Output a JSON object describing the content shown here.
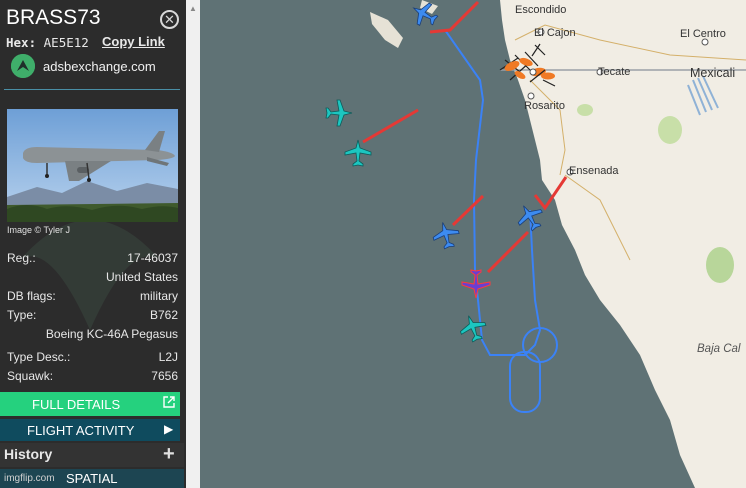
{
  "aircraft": {
    "callsign": "BRASS73",
    "hex_label": "Hex:",
    "hex_value": "AE5E12",
    "copy_link": "Copy Link",
    "source_site": "adsbexchange.com",
    "photo_credit": "Image © Tyler J",
    "details": [
      {
        "label": "Reg.:",
        "value": "17-46037"
      },
      {
        "label": "",
        "value": "United States"
      },
      {
        "label": "DB flags:",
        "value": "military"
      },
      {
        "label": "Type:",
        "value": "B762"
      },
      {
        "label": "",
        "value": "Boeing KC-46A Pegasus"
      },
      {
        "label": "Type Desc.:",
        "value": "L2J"
      },
      {
        "label": "Squawk:",
        "value": "7656"
      }
    ]
  },
  "buttons": {
    "full_details": "FULL DETAILS",
    "flight_activity": "FLIGHT ACTIVITY",
    "history": "History",
    "spatial": "SPATIAL",
    "watermark": "imgflip.com"
  },
  "map": {
    "places": [
      "Escondido",
      "El Cajon",
      "El Centro",
      "Tecate",
      "Mexicali",
      "Rosarito",
      "Ensenada",
      "Baja Cal"
    ],
    "colors": {
      "ocean": "#5f7275",
      "land": "#f1ede4",
      "track": "#3b82f6",
      "trail": "#e53935",
      "aircraft_cyan": "#1cc6c0",
      "aircraft_blue": "#3d8bf0",
      "aircraft_purple": "#6a3fd1",
      "aircraft_orange": "#f07a25",
      "accent_green": "#25d17e"
    }
  }
}
